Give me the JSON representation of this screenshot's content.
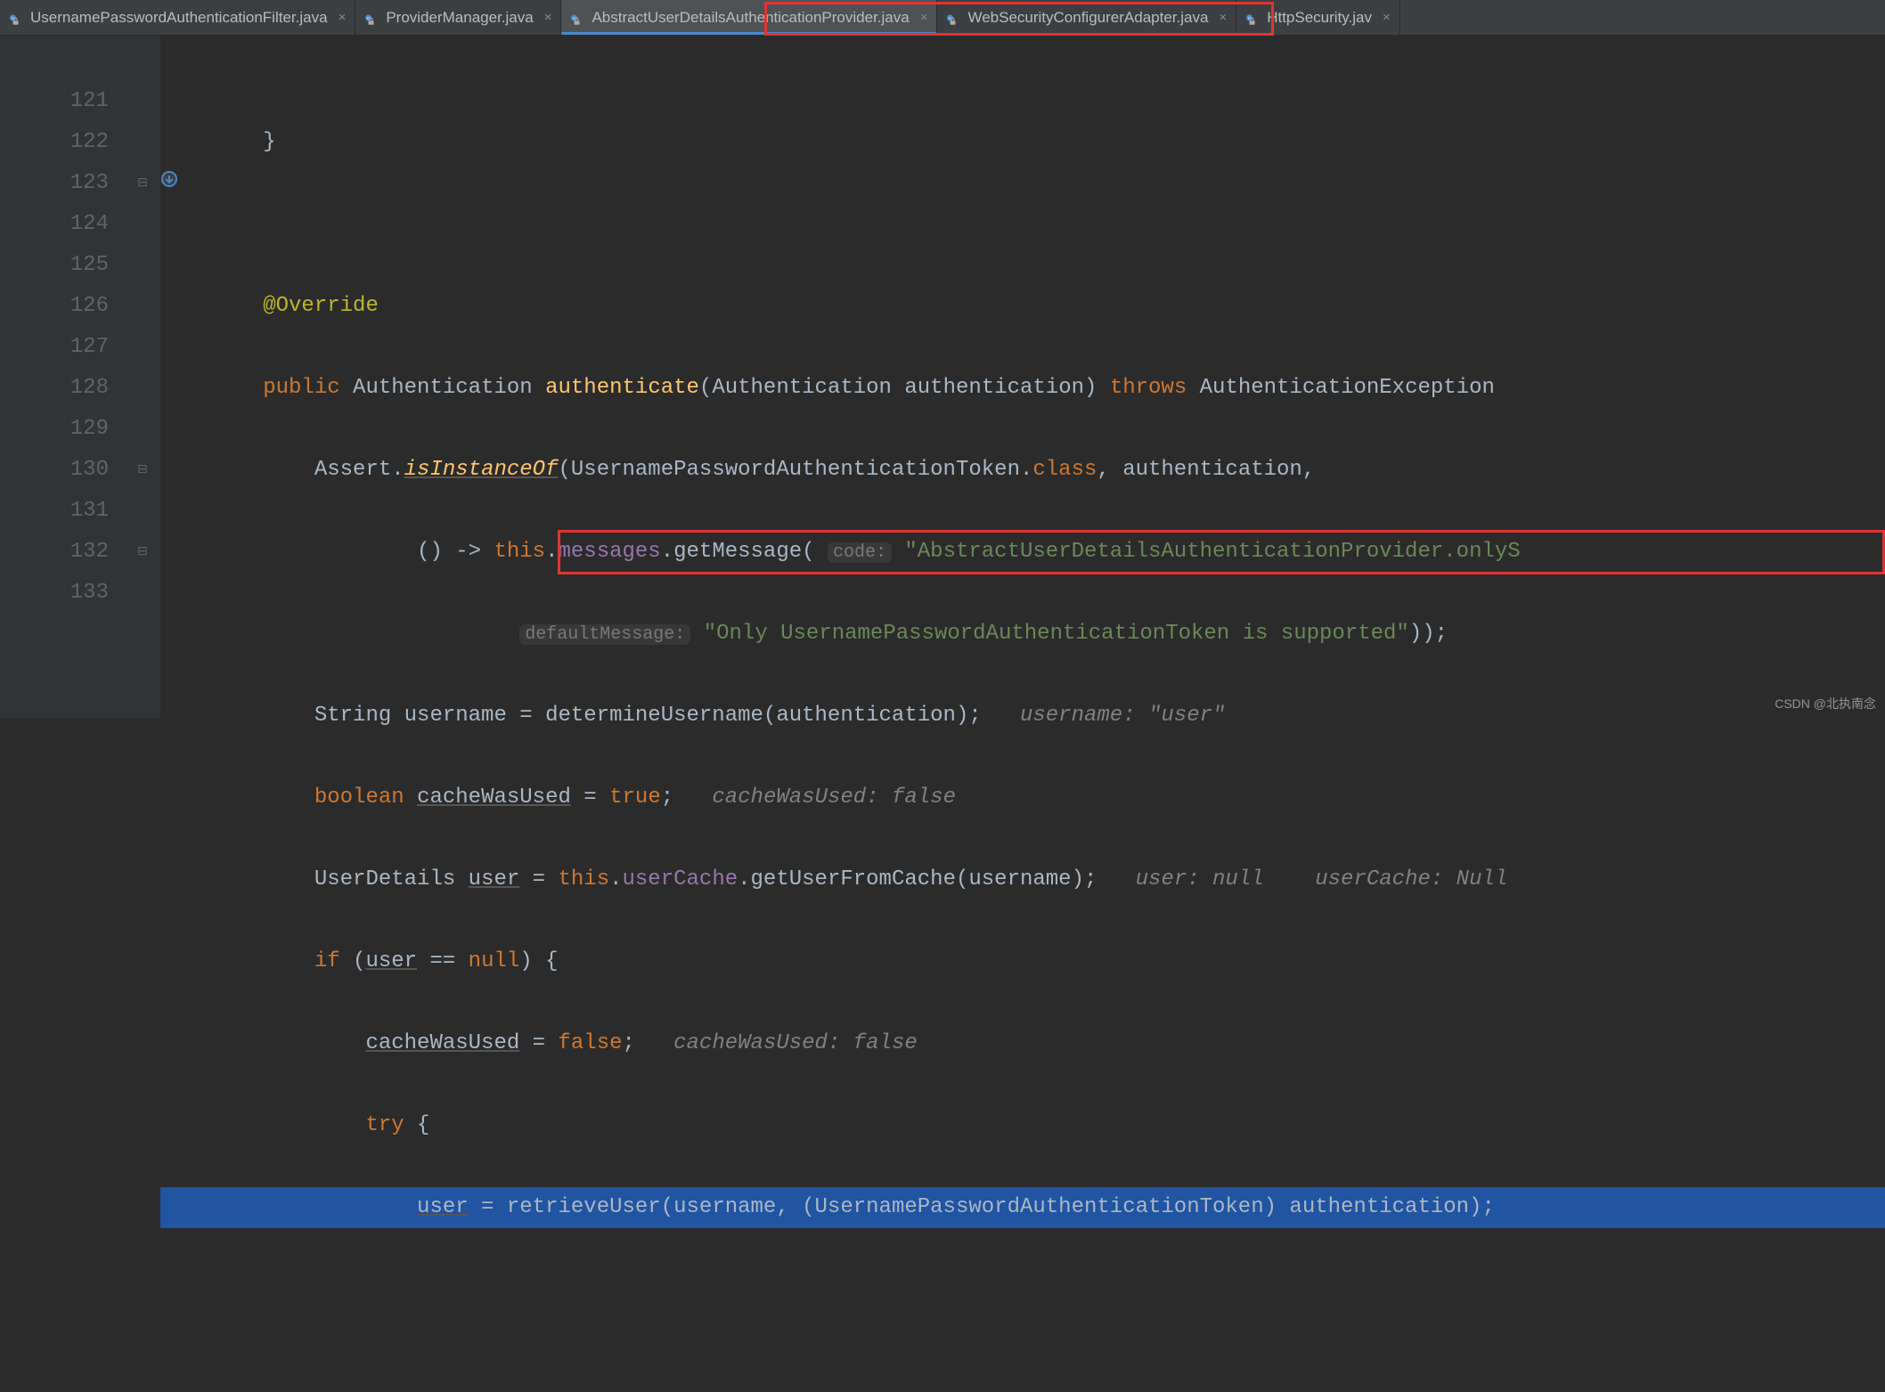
{
  "tabs": [
    {
      "label": "UsernamePasswordAuthenticationFilter.java",
      "active": false
    },
    {
      "label": "ProviderManager.java",
      "active": false
    },
    {
      "label": "AbstractUserDetailsAuthenticationProvider.java",
      "active": true
    },
    {
      "label": "WebSecurityConfigurerAdapter.java",
      "active": false
    },
    {
      "label": "HttpSecurity.jav",
      "active": false
    }
  ],
  "line_start": 121,
  "line_end": 133,
  "code": {
    "override": "@Override",
    "sig_public": "public",
    "sig_type": "Authentication",
    "sig_name": "authenticate",
    "sig_params": "(Authentication authentication)",
    "sig_throws": "throws",
    "sig_exc": "AuthenticationException",
    "assert_call": "Assert.",
    "assert_fn": "isInstanceOf",
    "assert_arg1": "(UsernamePasswordAuthenticationToken.",
    "assert_class": "class",
    "assert_tail": ", authentication,",
    "lambda_head": "() -> ",
    "lambda_this": "this",
    "lambda_dot": ".",
    "lambda_msgs": "messages",
    "lambda_get": ".getMessage(",
    "hint_code": "code:",
    "code_str": "\"AbstractUserDetailsAuthenticationProvider.onlyS",
    "hint_default": "defaultMessage:",
    "default_str": "\"Only UsernamePasswordAuthenticationToken is supported\"",
    "default_tail": "));",
    "l127a": "String username = determineUsername(authentication);",
    "l127c": "username: \"user\"",
    "l128kw": "boolean",
    "l128var": "cacheWasUsed",
    "l128rest": " = ",
    "l128true": "true",
    "l128semi": ";",
    "l128c": "cacheWasUsed: false",
    "l129a": "UserDetails ",
    "l129user": "user",
    "l129b": " = ",
    "l129this": "this",
    "l129c": ".",
    "l129cache": "userCache",
    "l129d": ".getUserFromCache(username);",
    "l129hint1": "user: null",
    "l129hint2": "userCache: Null",
    "l130kw": "if",
    "l130a": " (",
    "l130user": "user",
    "l130b": " == ",
    "l130null": "null",
    "l130c": ") {",
    "l131var": "cacheWasUsed",
    "l131a": " = ",
    "l131false": "false",
    "l131b": ";",
    "l131c": "cacheWasUsed: false",
    "l132kw": "try",
    "l132a": " {",
    "l133var": "user",
    "l133a": " = ",
    "l133fn": "retrieveUser",
    "l133b": "(username, (UsernamePasswordAuthenticationToken) authentication);"
  },
  "watermark": "CSDN @北执南念"
}
